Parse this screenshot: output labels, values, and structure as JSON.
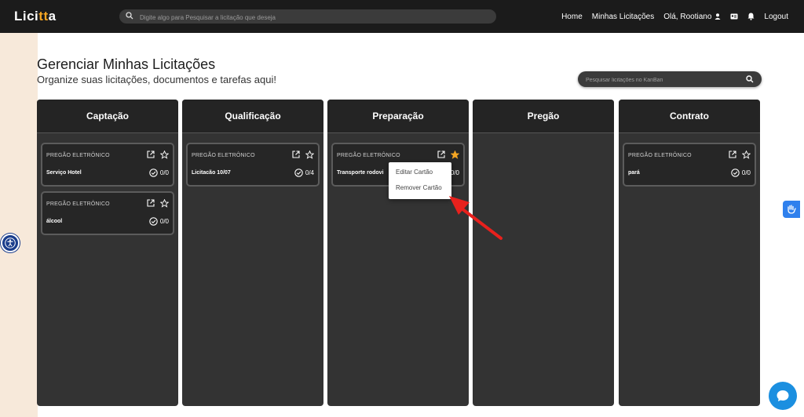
{
  "app": {
    "logo_text_start": "Lici",
    "logo_text_accent": "tt",
    "logo_text_end": "a"
  },
  "navbar": {
    "search_placeholder": "Digite algo para Pesquisar a licitação que deseja",
    "links": [
      {
        "label": "Home"
      },
      {
        "label": "Minhas Licitações"
      },
      {
        "label": "Olá, Rootiano"
      },
      {
        "label": "Logout"
      }
    ]
  },
  "header": {
    "title": "Gerenciar Minhas Licitações",
    "subtitle": "Organize suas licitações, documentos e tarefas aqui!",
    "kanban_search_placeholder": "Pesquisar licitações no KanBan"
  },
  "columns": [
    {
      "title": "Captação",
      "cards": [
        {
          "type": "PREGÃO ELETRÔNICO",
          "title": "Serviço Hotel",
          "progress": "0/0",
          "starred": false
        },
        {
          "type": "PREGÃO ELETRÔNICO",
          "title": "álcool",
          "progress": "0/0",
          "starred": false
        }
      ]
    },
    {
      "title": "Qualificação",
      "cards": [
        {
          "type": "PREGÃO ELETRÔNICO",
          "title": "Licitacão 10/07",
          "progress": "0/4",
          "starred": false
        }
      ]
    },
    {
      "title": "Preparação",
      "cards": [
        {
          "type": "PREGÃO ELETRÔNICO",
          "title": "Transporte rodovi",
          "progress": "0/0",
          "starred": true
        }
      ]
    },
    {
      "title": "Pregão",
      "cards": []
    },
    {
      "title": "Contrato",
      "cards": [
        {
          "type": "PREGÃO ELETRÔNICO",
          "title": "pará",
          "progress": "0/0",
          "starred": false
        }
      ]
    }
  ],
  "context_menu": {
    "items": [
      {
        "label": "Editar Cartão"
      },
      {
        "label": "Remover Cartão"
      }
    ]
  },
  "colors": {
    "accent": "#f5a623",
    "navbar": "#1b1b1b",
    "column": "#333333",
    "annotation_arrow": "#e8211d",
    "chat": "#1b8fe0"
  },
  "icons": [
    "search-icon",
    "user-icon",
    "id-card-icon",
    "bell-icon",
    "external-link-icon",
    "star-icon",
    "check-circle-icon",
    "accessibility-icon",
    "sign-language-icon",
    "chat-icon"
  ]
}
